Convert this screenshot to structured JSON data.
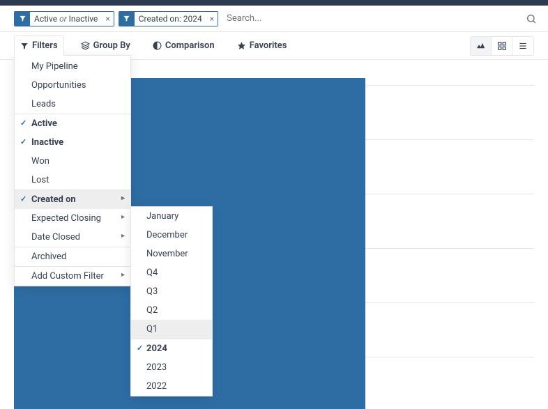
{
  "search": {
    "placeholder": "Search...",
    "chips": [
      {
        "parts": [
          "Active",
          "Inactive"
        ],
        "joiner": "or"
      },
      {
        "text": "Created on: 2024"
      }
    ]
  },
  "toolbar": {
    "filters": "Filters",
    "group_by": "Group By",
    "comparison": "Comparison",
    "favorites": "Favorites"
  },
  "filters_menu": {
    "section1": [
      "My Pipeline",
      "Opportunities",
      "Leads"
    ],
    "section2": [
      {
        "label": "Active",
        "checked": true
      },
      {
        "label": "Inactive",
        "checked": true
      },
      {
        "label": "Won",
        "checked": false
      },
      {
        "label": "Lost",
        "checked": false
      }
    ],
    "section3": [
      {
        "label": "Created on",
        "submenu": true,
        "checked": true,
        "open": true
      },
      {
        "label": "Expected Closing",
        "submenu": true,
        "checked": false
      },
      {
        "label": "Date Closed",
        "submenu": true,
        "checked": false
      }
    ],
    "section4": [
      "Archived"
    ],
    "section5": [
      {
        "label": "Add Custom Filter",
        "submenu": true
      }
    ]
  },
  "created_on_submenu": {
    "months": [
      "January",
      "December",
      "November"
    ],
    "quarters": [
      "Q4",
      "Q3",
      "Q2",
      "Q1"
    ],
    "hover": "Q1",
    "years": [
      {
        "label": "2024",
        "checked": true
      },
      {
        "label": "2023",
        "checked": false
      },
      {
        "label": "2022",
        "checked": false
      }
    ]
  },
  "colors": {
    "primary": "#2e6da4"
  }
}
